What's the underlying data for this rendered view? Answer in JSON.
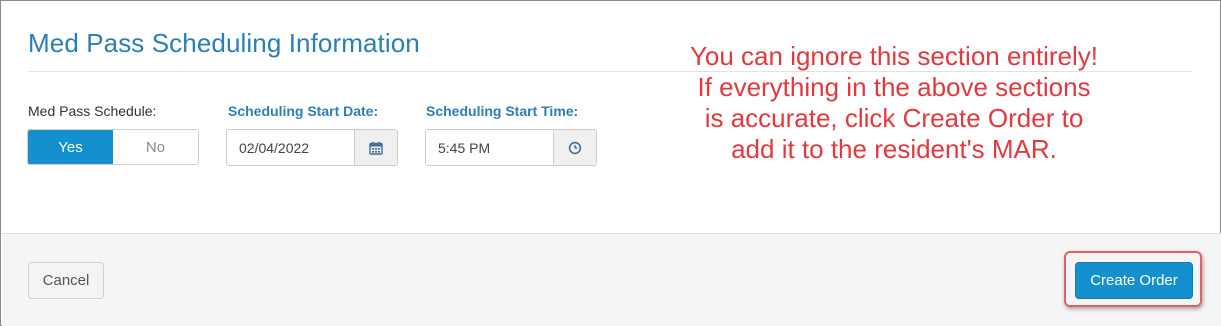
{
  "section": {
    "title": "Med Pass Scheduling Information"
  },
  "schedule": {
    "label": "Med Pass Schedule:",
    "yes_label": "Yes",
    "no_label": "No",
    "selected": "Yes"
  },
  "start_date": {
    "label": "Scheduling Start Date:",
    "value": "02/04/2022",
    "icon": "calendar-icon"
  },
  "start_time": {
    "label": "Scheduling Start Time:",
    "value": "5:45 PM",
    "icon": "clock-icon"
  },
  "annotation": {
    "text": "You can ignore this section entirely! If everything in the above sections is accurate, click Create Order to add it to the resident's MAR."
  },
  "footer": {
    "cancel_label": "Cancel",
    "create_label": "Create Order"
  },
  "colors": {
    "accent": "#1590cf",
    "title": "#2a7fb8",
    "annotation": "#e4383f",
    "highlight": "#e06262"
  }
}
